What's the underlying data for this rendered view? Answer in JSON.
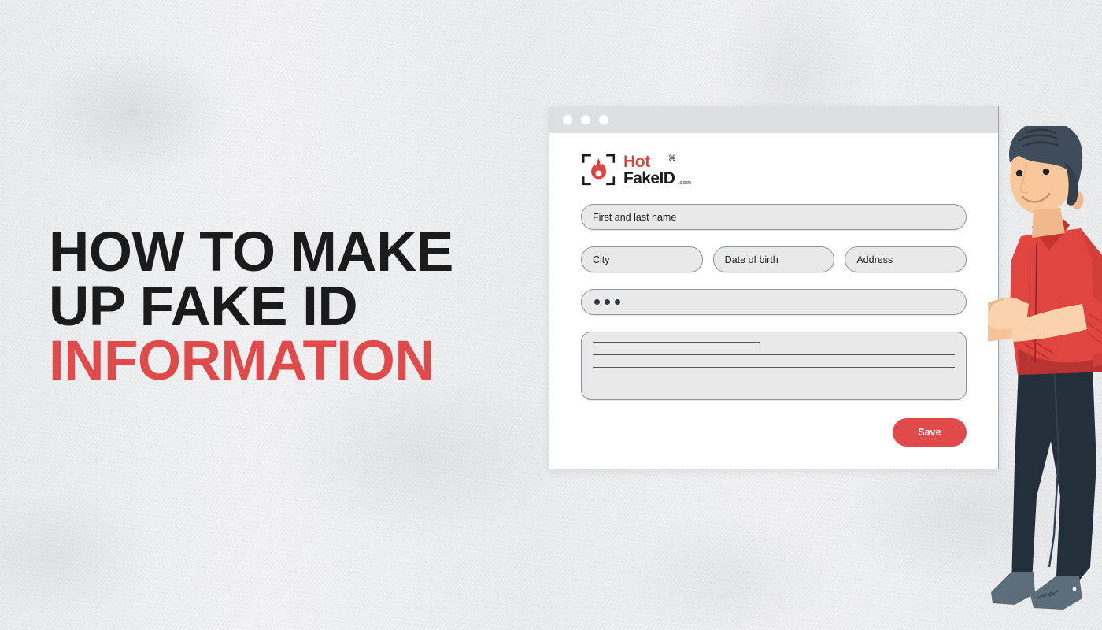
{
  "page": {
    "background_color": "#f3f3f4",
    "accent_color": "#e04a4a",
    "dark_color": "#1b1b1b"
  },
  "headline": {
    "line1": "HOW TO MAKE",
    "line2": "UP FAKE ID",
    "line3": "INFORMATION"
  },
  "browser_window": {
    "traffic_lights": [
      "dot-1",
      "dot-2",
      "dot-3"
    ],
    "titlebar_color": "#dedfe0"
  },
  "logo": {
    "icon_name": "flame-scan-icon",
    "word_top": "Hot",
    "word_bottom": "FakeID",
    "suffix": ".com",
    "badge_glyph": "⌘",
    "hot_color": "#e0433f",
    "fake_color": "#1c1c1c"
  },
  "form": {
    "fields": [
      {
        "name": "full-name-field",
        "label": "First and last name"
      },
      {
        "name": "city-field",
        "label": "City"
      },
      {
        "name": "date-of-birth-field",
        "label": "Date of birth"
      },
      {
        "name": "address-field",
        "label": "Address"
      }
    ],
    "password_field": {
      "name": "password-field",
      "masked_value": "●●●",
      "dot_count": 3
    },
    "notes_field": {
      "name": "notes-textarea",
      "line_count": 3,
      "line_widths": [
        "46%",
        "100%",
        "100%"
      ]
    },
    "save_button": {
      "label": "Save",
      "color": "#e04a4a",
      "text_color": "#ffffff"
    }
  },
  "illustration": {
    "name": "man-holding-laptop",
    "shirt_color": "#e0453f",
    "shirt_shadow": "#b8322f",
    "pants_color": "#232f3a",
    "hair_color": "#3f4d5a",
    "skin_color": "#f7c49a",
    "skin_light": "#fad3ae",
    "shoe_color": "#5d6e7a",
    "laptop_color": "#3c4a57",
    "laptop_dark": "#2a3540"
  }
}
